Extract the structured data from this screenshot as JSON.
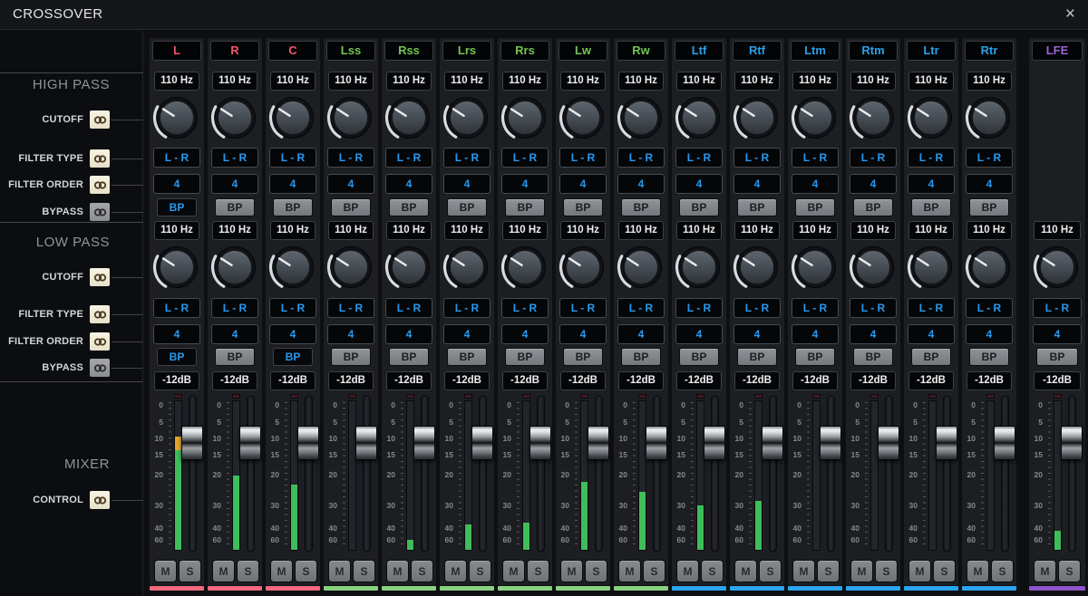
{
  "window": {
    "title": "CROSSOVER",
    "close": "×"
  },
  "sidebar": {
    "sections": [
      {
        "title": "HIGH PASS",
        "rows": [
          {
            "label": "CUTOFF",
            "linked": true
          },
          {
            "label": "FILTER TYPE",
            "linked": true
          },
          {
            "label": "FILTER ORDER",
            "linked": true
          },
          {
            "label": "BYPASS",
            "linked": false
          }
        ]
      },
      {
        "title": "LOW PASS",
        "rows": [
          {
            "label": "CUTOFF",
            "linked": true
          },
          {
            "label": "FILTER TYPE",
            "linked": true
          },
          {
            "label": "FILTER ORDER",
            "linked": true
          },
          {
            "label": "BYPASS",
            "linked": false
          }
        ]
      },
      {
        "title": "MIXER",
        "rows": [
          {
            "label": "CONTROL",
            "linked": true
          }
        ]
      }
    ]
  },
  "strip_labels": {
    "bypass": "BP",
    "mute": "M",
    "solo": "S"
  },
  "fader_scale": [
    "0",
    "5",
    "10",
    "15",
    "20",
    "30",
    "40",
    "60"
  ],
  "colors": {
    "front": "#f2566a",
    "front_bar": "#f0697c",
    "surround": "#72c356",
    "surround_bar": "#87d17e",
    "height": "#2ba0e9",
    "height_bar": "#2aa4f0",
    "lfe": "#9c63d9",
    "lfe_bar": "#8d53c9",
    "accent_blue": "#2699f0",
    "meter_green": "#3ebd5a",
    "meter_yellow": "#e2a62e"
  },
  "channels": [
    {
      "name": "L",
      "group": "front",
      "high_pass": {
        "cutoff": "110 Hz",
        "filter_type": "L - R",
        "filter_order": "4",
        "bypass_on": true
      },
      "low_pass": {
        "cutoff": "110 Hz",
        "filter_type": "L - R",
        "filter_order": "4",
        "bypass_on": true
      },
      "trim": "-12dB",
      "meter_pct": 76,
      "meter_peak": true
    },
    {
      "name": "R",
      "group": "front",
      "high_pass": {
        "cutoff": "110 Hz",
        "filter_type": "L - R",
        "filter_order": "4",
        "bypass_on": false
      },
      "low_pass": {
        "cutoff": "110 Hz",
        "filter_type": "L - R",
        "filter_order": "4",
        "bypass_on": false
      },
      "trim": "-12dB",
      "meter_pct": 50,
      "meter_peak": false
    },
    {
      "name": "C",
      "group": "front",
      "high_pass": {
        "cutoff": "110 Hz",
        "filter_type": "L - R",
        "filter_order": "4",
        "bypass_on": false
      },
      "low_pass": {
        "cutoff": "110 Hz",
        "filter_type": "L - R",
        "filter_order": "4",
        "bypass_on": true
      },
      "trim": "-12dB",
      "meter_pct": 44,
      "meter_peak": false
    },
    {
      "name": "Lss",
      "group": "surround",
      "high_pass": {
        "cutoff": "110 Hz",
        "filter_type": "L - R",
        "filter_order": "4",
        "bypass_on": false
      },
      "low_pass": {
        "cutoff": "110 Hz",
        "filter_type": "L - R",
        "filter_order": "4",
        "bypass_on": false
      },
      "trim": "-12dB",
      "meter_pct": 0,
      "meter_peak": false
    },
    {
      "name": "Rss",
      "group": "surround",
      "high_pass": {
        "cutoff": "110 Hz",
        "filter_type": "L - R",
        "filter_order": "4",
        "bypass_on": false
      },
      "low_pass": {
        "cutoff": "110 Hz",
        "filter_type": "L - R",
        "filter_order": "4",
        "bypass_on": false
      },
      "trim": "-12dB",
      "meter_pct": 7,
      "meter_peak": false
    },
    {
      "name": "Lrs",
      "group": "surround",
      "high_pass": {
        "cutoff": "110 Hz",
        "filter_type": "L - R",
        "filter_order": "4",
        "bypass_on": false
      },
      "low_pass": {
        "cutoff": "110 Hz",
        "filter_type": "L - R",
        "filter_order": "4",
        "bypass_on": false
      },
      "trim": "-12dB",
      "meter_pct": 17,
      "meter_peak": false
    },
    {
      "name": "Rrs",
      "group": "surround",
      "high_pass": {
        "cutoff": "110 Hz",
        "filter_type": "L - R",
        "filter_order": "4",
        "bypass_on": false
      },
      "low_pass": {
        "cutoff": "110 Hz",
        "filter_type": "L - R",
        "filter_order": "4",
        "bypass_on": false
      },
      "trim": "-12dB",
      "meter_pct": 18,
      "meter_peak": false
    },
    {
      "name": "Lw",
      "group": "surround",
      "high_pass": {
        "cutoff": "110 Hz",
        "filter_type": "L - R",
        "filter_order": "4",
        "bypass_on": false
      },
      "low_pass": {
        "cutoff": "110 Hz",
        "filter_type": "L - R",
        "filter_order": "4",
        "bypass_on": false
      },
      "trim": "-12dB",
      "meter_pct": 46,
      "meter_peak": false
    },
    {
      "name": "Rw",
      "group": "surround",
      "high_pass": {
        "cutoff": "110 Hz",
        "filter_type": "L - R",
        "filter_order": "4",
        "bypass_on": false
      },
      "low_pass": {
        "cutoff": "110 Hz",
        "filter_type": "L - R",
        "filter_order": "4",
        "bypass_on": false
      },
      "trim": "-12dB",
      "meter_pct": 39,
      "meter_peak": false
    },
    {
      "name": "Ltf",
      "group": "height",
      "high_pass": {
        "cutoff": "110 Hz",
        "filter_type": "L - R",
        "filter_order": "4",
        "bypass_on": false
      },
      "low_pass": {
        "cutoff": "110 Hz",
        "filter_type": "L - R",
        "filter_order": "4",
        "bypass_on": false
      },
      "trim": "-12dB",
      "meter_pct": 30,
      "meter_peak": false
    },
    {
      "name": "Rtf",
      "group": "height",
      "high_pass": {
        "cutoff": "110 Hz",
        "filter_type": "L - R",
        "filter_order": "4",
        "bypass_on": false
      },
      "low_pass": {
        "cutoff": "110 Hz",
        "filter_type": "L - R",
        "filter_order": "4",
        "bypass_on": false
      },
      "trim": "-12dB",
      "meter_pct": 33,
      "meter_peak": false
    },
    {
      "name": "Ltm",
      "group": "height",
      "high_pass": {
        "cutoff": "110 Hz",
        "filter_type": "L - R",
        "filter_order": "4",
        "bypass_on": false
      },
      "low_pass": {
        "cutoff": "110 Hz",
        "filter_type": "L - R",
        "filter_order": "4",
        "bypass_on": false
      },
      "trim": "-12dB",
      "meter_pct": 0,
      "meter_peak": false
    },
    {
      "name": "Rtm",
      "group": "height",
      "high_pass": {
        "cutoff": "110 Hz",
        "filter_type": "L - R",
        "filter_order": "4",
        "bypass_on": false
      },
      "low_pass": {
        "cutoff": "110 Hz",
        "filter_type": "L - R",
        "filter_order": "4",
        "bypass_on": false
      },
      "trim": "-12dB",
      "meter_pct": 0,
      "meter_peak": false
    },
    {
      "name": "Ltr",
      "group": "height",
      "high_pass": {
        "cutoff": "110 Hz",
        "filter_type": "L - R",
        "filter_order": "4",
        "bypass_on": false
      },
      "low_pass": {
        "cutoff": "110 Hz",
        "filter_type": "L - R",
        "filter_order": "4",
        "bypass_on": false
      },
      "trim": "-12dB",
      "meter_pct": 0,
      "meter_peak": false
    },
    {
      "name": "Rtr",
      "group": "height",
      "high_pass": {
        "cutoff": "110 Hz",
        "filter_type": "L - R",
        "filter_order": "4",
        "bypass_on": false
      },
      "low_pass": {
        "cutoff": "110 Hz",
        "filter_type": "L - R",
        "filter_order": "4",
        "bypass_on": false
      },
      "trim": "-12dB",
      "meter_pct": 0,
      "meter_peak": false
    },
    {
      "name": "LFE",
      "group": "lfe",
      "high_pass": null,
      "low_pass": {
        "cutoff": "110 Hz",
        "filter_type": "L - R",
        "filter_order": "4",
        "bypass_on": false
      },
      "trim": "-12dB",
      "meter_pct": 13,
      "meter_peak": false
    }
  ]
}
